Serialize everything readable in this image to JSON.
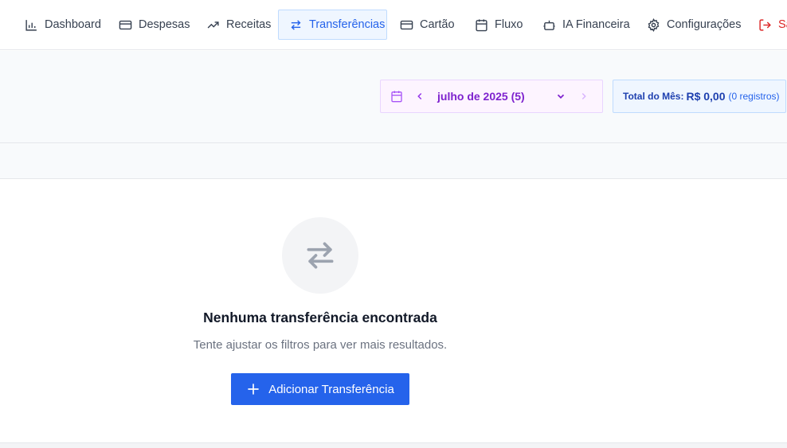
{
  "nav": {
    "items": [
      {
        "label": "Dashboard",
        "icon": "bar-chart-icon"
      },
      {
        "label": "Despesas",
        "icon": "credit-card-icon"
      },
      {
        "label": "Receitas",
        "icon": "trending-up-icon"
      },
      {
        "label": "Transferências",
        "icon": "transfer-arrows-icon",
        "active": true
      },
      {
        "label": "Cartão",
        "icon": "credit-card-icon"
      },
      {
        "label": "Fluxo",
        "icon": "calendar-icon"
      },
      {
        "label": "IA Financeira",
        "icon": "robot-icon"
      },
      {
        "label": "Configurações",
        "icon": "gear-icon"
      },
      {
        "label": "Sa",
        "icon": "logout-icon"
      }
    ]
  },
  "month_picker": {
    "label": "julho de 2025 (5)",
    "icons": [
      "calendar-icon",
      "chevron-left-icon",
      "chevron-down-icon",
      "chevron-right-icon"
    ]
  },
  "total": {
    "label": "Total do Mês:",
    "value": "R$ 0,00",
    "count": "(0 registros)"
  },
  "empty_state": {
    "icon": "transfer-arrows-icon",
    "title": "Nenhuma transferência encontrada",
    "subtitle": "Tente ajustar os filtros para ver mais resultados.",
    "button_label": "Adicionar Transferência"
  },
  "colors": {
    "accent": "#2563eb",
    "month_accent": "#7e22ce",
    "logout": "#dc2626"
  }
}
